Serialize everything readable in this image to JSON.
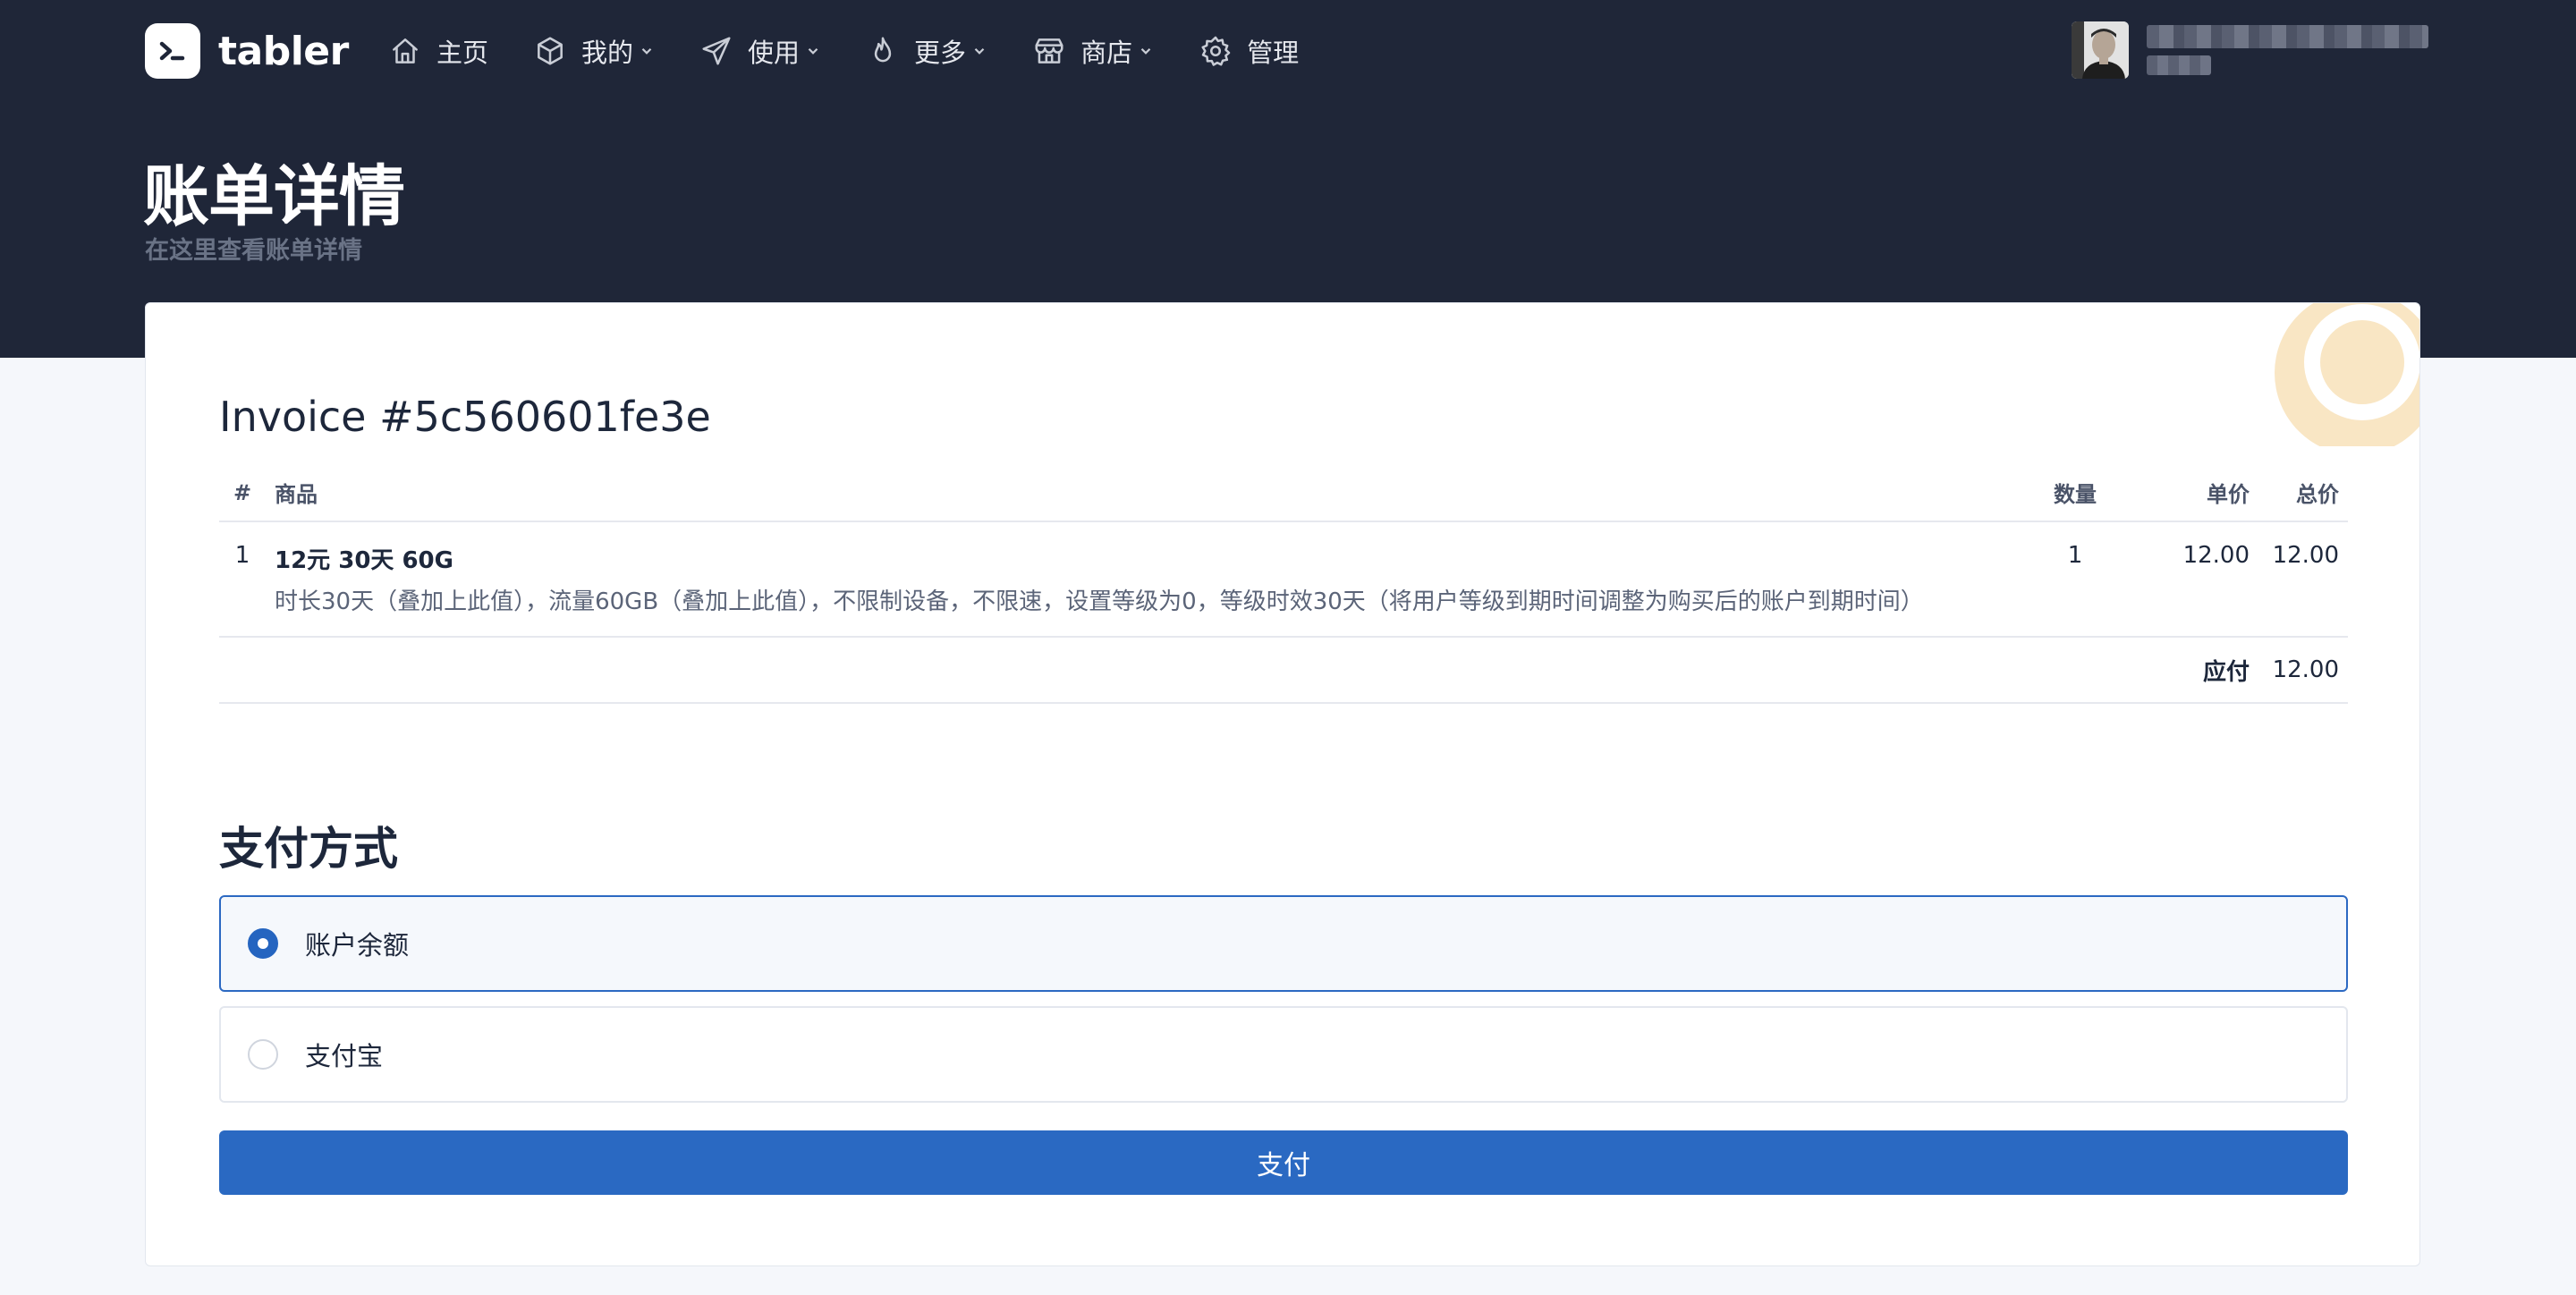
{
  "brand": {
    "name": "tabler"
  },
  "nav": {
    "items": [
      {
        "label": "主页",
        "icon": "home-icon",
        "dropdown": false
      },
      {
        "label": "我的",
        "icon": "box-icon",
        "dropdown": true
      },
      {
        "label": "使用",
        "icon": "send-icon",
        "dropdown": true
      },
      {
        "label": "更多",
        "icon": "flame-icon",
        "dropdown": true
      },
      {
        "label": "商店",
        "icon": "store-icon",
        "dropdown": true
      },
      {
        "label": "管理",
        "icon": "gear-icon",
        "dropdown": false
      }
    ]
  },
  "user": {
    "name": "",
    "role": ""
  },
  "header": {
    "title": "账单详情",
    "subtitle": "在这里查看账单详情"
  },
  "invoice": {
    "title": "Invoice #5c560601fe3e",
    "columns": {
      "num": "#",
      "product": "商品",
      "qty": "数量",
      "unit_price": "单价",
      "total": "总价"
    },
    "items": [
      {
        "num": "1",
        "name": "12元 30天 60G",
        "description": "时长30天（叠加上此值），流量60GB（叠加上此值），不限制设备，不限速，设置等级为0，等级时效30天（将用户等级到期时间调整为购买后的账户到期时间）",
        "qty": "1",
        "unit_price": "12.00",
        "total": "12.00"
      }
    ],
    "due_label": "应付",
    "due_amount": "12.00",
    "status_icon": "clock-icon",
    "status_color": "#f9e6c4"
  },
  "payment": {
    "title": "支付方式",
    "options": [
      {
        "label": "账户余额",
        "selected": true
      },
      {
        "label": "支付宝",
        "selected": false
      }
    ],
    "submit_label": "支付",
    "accent_color": "#2a69c2"
  }
}
